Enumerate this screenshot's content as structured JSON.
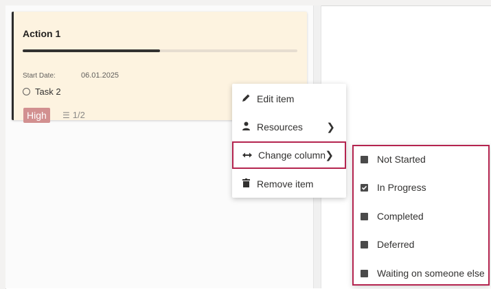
{
  "card": {
    "title": "Action 1",
    "progress": 0.5,
    "start_label": "Start Date:",
    "start_value": "06.01.2025",
    "task": "Task 2",
    "priority": "High",
    "checklist": "1/2"
  },
  "menu": {
    "items": [
      {
        "label": "Edit item",
        "icon": "pencil-icon"
      },
      {
        "label": "Resources",
        "icon": "person-icon"
      },
      {
        "label": "Change column",
        "icon": "arrows-horizontal-icon"
      },
      {
        "label": "Remove item",
        "icon": "trash-icon"
      }
    ]
  },
  "submenu": {
    "items": [
      {
        "label": "Not Started",
        "checked": false
      },
      {
        "label": "In Progress",
        "checked": true
      },
      {
        "label": "Completed",
        "checked": false
      },
      {
        "label": "Deferred",
        "checked": false
      },
      {
        "label": "Waiting on someone else",
        "checked": false
      }
    ]
  },
  "colors": {
    "card_bg": "#fdf3e0",
    "priority_bg": "#d29090",
    "highlight_border": "#b4234e"
  }
}
